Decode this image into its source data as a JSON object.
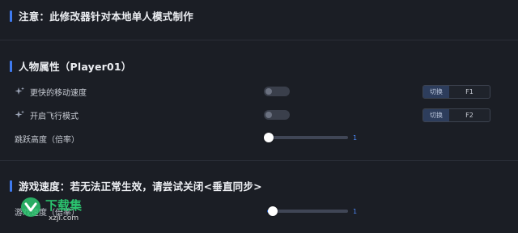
{
  "notice": {
    "title": "注意：此修改器针对本地单人模式制作"
  },
  "player_section": {
    "title": "人物属性（Player01）",
    "rows": [
      {
        "label": "更快的移动速度",
        "icon": "sparkle-icon",
        "toggle_on": false,
        "hotkey_button": "切换",
        "hotkey": "F1"
      },
      {
        "label": "开启飞行模式",
        "icon": "sparkle-icon",
        "toggle_on": false,
        "hotkey_button": "切换",
        "hotkey": "F2"
      }
    ],
    "jump": {
      "label": "跳跃高度（倍率）",
      "value": "1",
      "fraction": 0
    }
  },
  "speed_section": {
    "title": "游戏速度：若无法正常生效，请尝试关闭<垂直同步>",
    "speed": {
      "label": "游戏速度（倍率）",
      "value": "1",
      "fraction": 0.05
    }
  },
  "watermark": {
    "name": "下载集",
    "domain": "xzji.com"
  },
  "colors": {
    "accent": "#3f7bf0",
    "background": "#1b1e25",
    "watermark_green": "#2bc46f"
  }
}
